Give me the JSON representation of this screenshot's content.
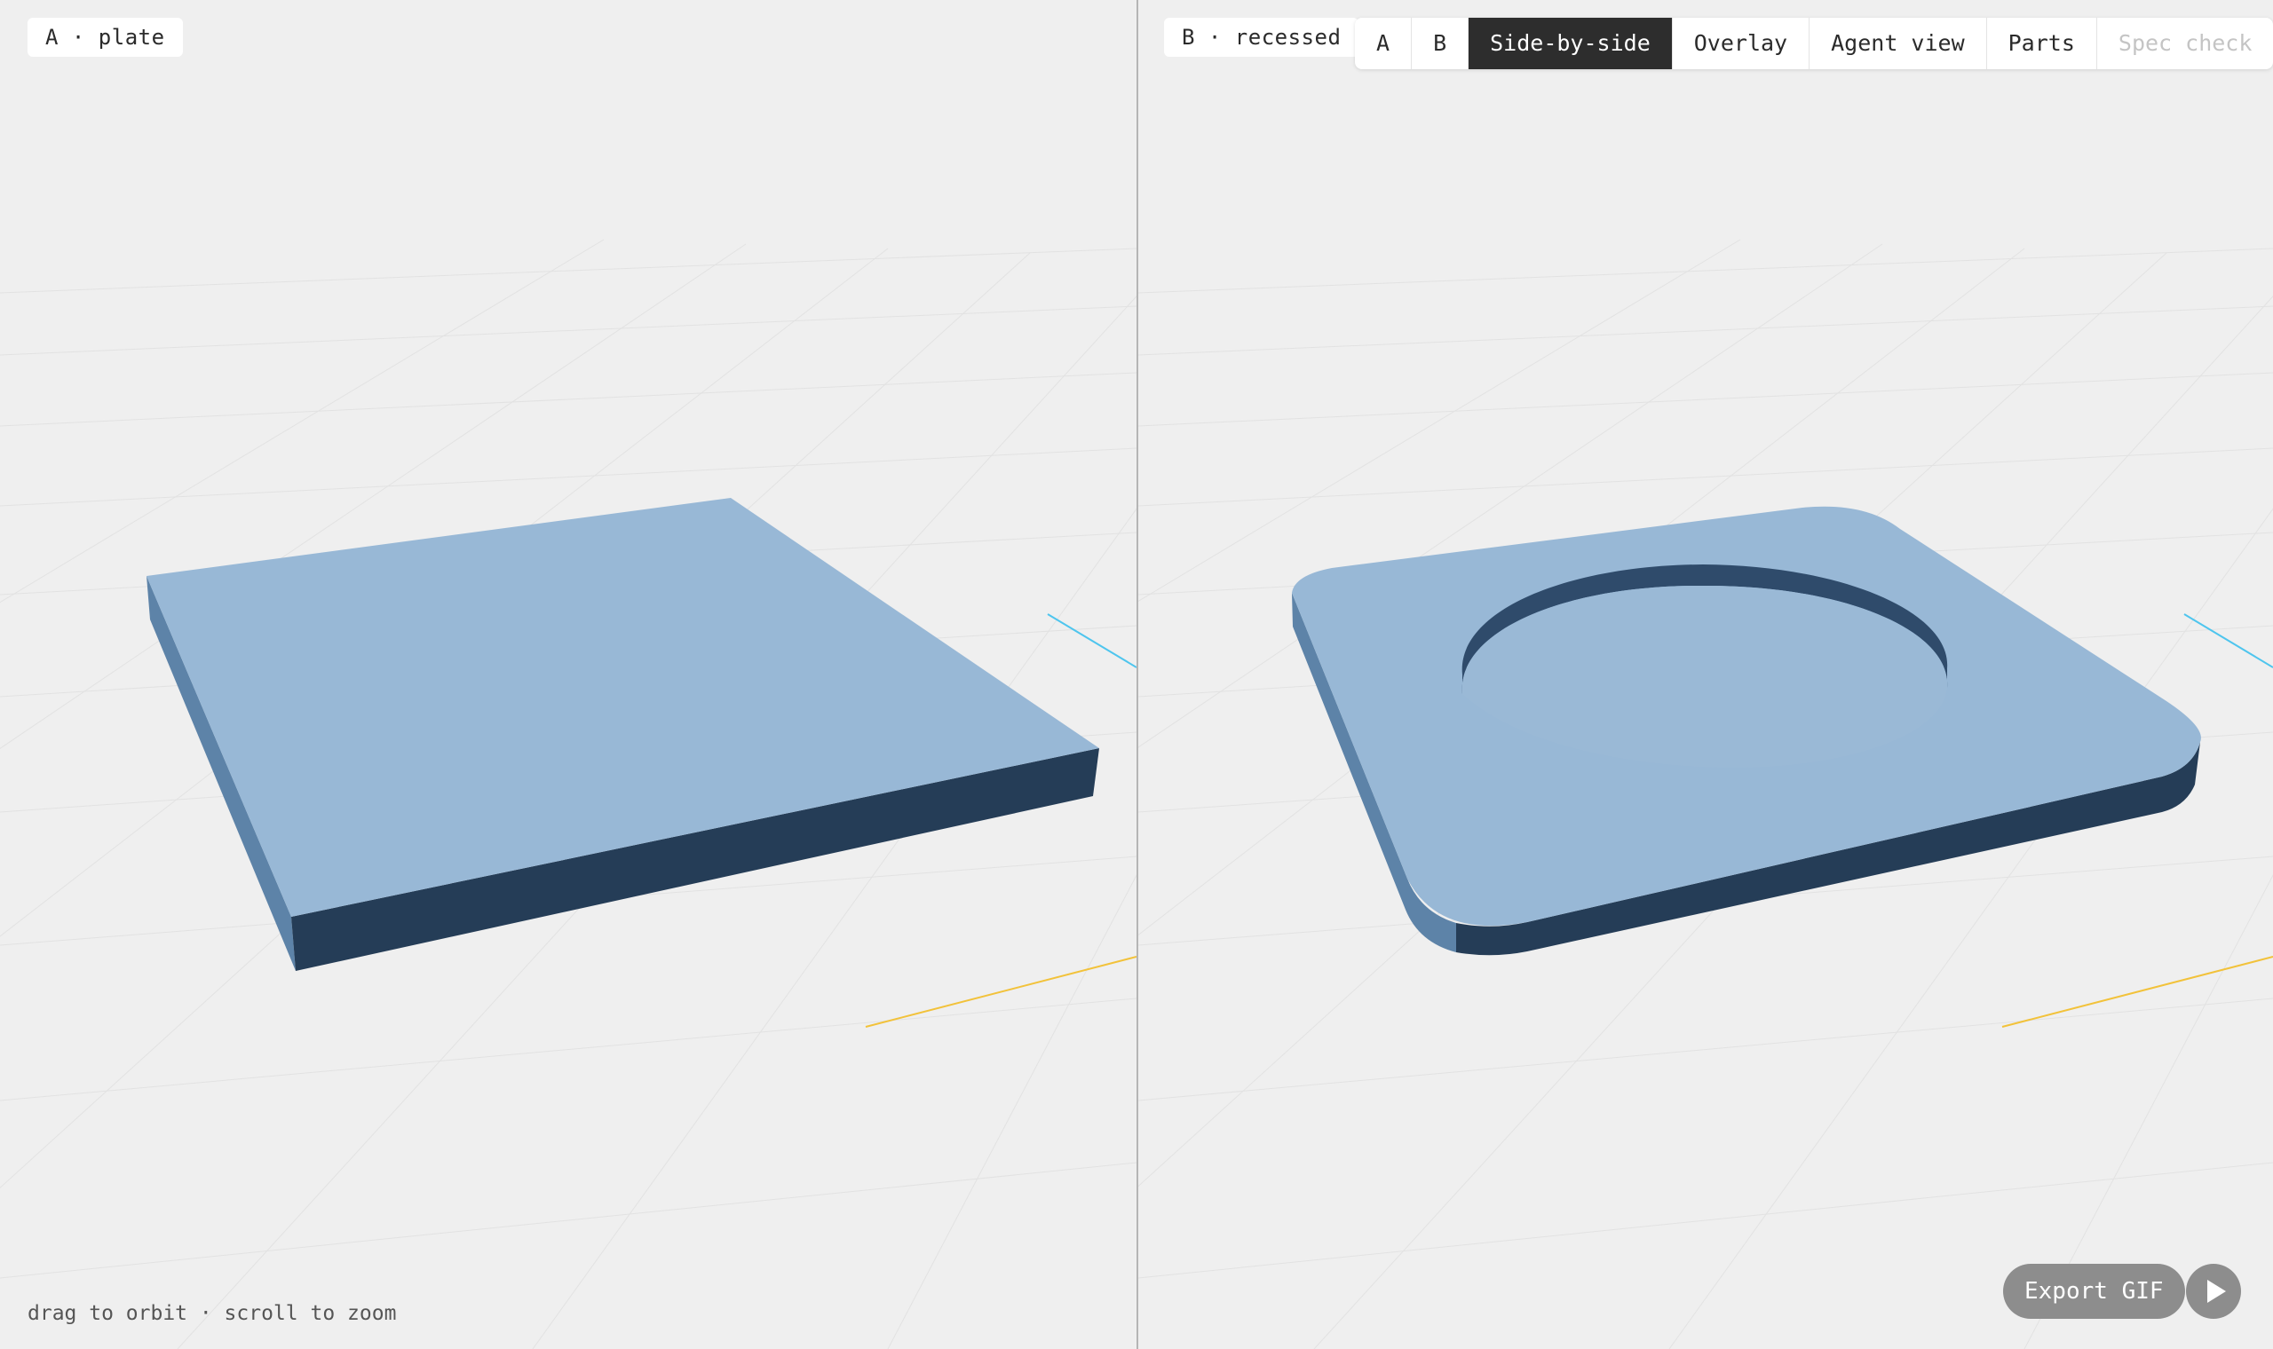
{
  "viewports": {
    "a": {
      "label": "A · plate",
      "model": "plate"
    },
    "b": {
      "label": "B · recessed",
      "model": "recessed plate with circular pocket"
    }
  },
  "toolbar": {
    "buttons": [
      {
        "label": "A",
        "state": "normal"
      },
      {
        "label": "B",
        "state": "normal"
      },
      {
        "label": "Side-by-side",
        "state": "active"
      },
      {
        "label": "Overlay",
        "state": "normal"
      },
      {
        "label": "Agent view",
        "state": "normal"
      },
      {
        "label": "Parts",
        "state": "normal"
      },
      {
        "label": "Spec check",
        "state": "disabled"
      }
    ]
  },
  "hint": "drag to orbit · scroll to zoom",
  "export": {
    "label": "Export GIF"
  },
  "colors": {
    "background": "#efefef",
    "model_top": "#98b8d6",
    "model_side_dark": "#253d57",
    "model_side_light": "#5d83a8",
    "active_button": "#2d2d2d",
    "axis_x": "#f2c23a",
    "axis_z": "#4ec5ee"
  },
  "icons": {
    "play": "play-icon"
  }
}
